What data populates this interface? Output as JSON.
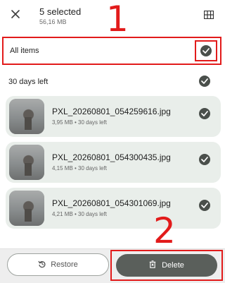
{
  "header": {
    "title": "5 selected",
    "subtitle": "56,16 MB"
  },
  "annotations": {
    "number_1": "1",
    "number_2": "2",
    "color": "#e21b1b"
  },
  "selection": {
    "all_items_label": "All items"
  },
  "section": {
    "label": "30 days left"
  },
  "files": [
    {
      "name": "PXL_20260801_054259616.jpg",
      "meta": "3,95 MB • 30 days left"
    },
    {
      "name": "PXL_20260801_054300435.jpg",
      "meta": "4,15 MB • 30 days left"
    },
    {
      "name": "PXL_20260801_054301069.jpg",
      "meta": "4,21 MB • 30 days left"
    }
  ],
  "actions": {
    "restore_label": "Restore",
    "delete_label": "Delete"
  },
  "colors": {
    "card_bg": "#e9eeea",
    "check_bg": "#4a4f4b",
    "delete_bg": "#5a5f5b"
  },
  "icons": {
    "close": "close-icon",
    "grid": "grid-view-icon",
    "check": "check-circle-icon",
    "restore": "restore-icon",
    "delete": "trash-icon"
  }
}
